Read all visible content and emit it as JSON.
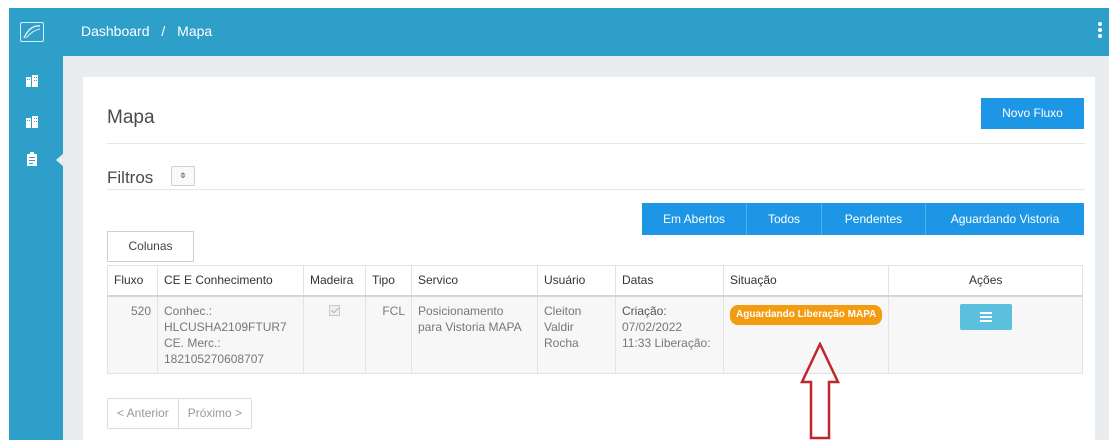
{
  "topbar": {
    "breadcrumb": [
      "Dashboard",
      "Mapa"
    ],
    "separator": "/"
  },
  "page": {
    "title": "Mapa",
    "new_button": "Novo Fluxo"
  },
  "filters": {
    "label": "Filtros",
    "toggle_icon": "eye-slash-icon",
    "buttons": [
      "Em Abertos",
      "Todos",
      "Pendentes",
      "Aguardando Vistoria"
    ]
  },
  "columns_button": "Colunas",
  "table": {
    "headers": [
      "Fluxo",
      "CE E Conhecimento",
      "Madeira",
      "Tipo",
      "Servico",
      "Usuário",
      "Datas",
      "Situação",
      "Ações"
    ],
    "rows": [
      {
        "fluxo": "520",
        "ce_lines": [
          "Conhec.:",
          "HLCUSHA2109FTUR7",
          "CE. Merc.:",
          "182105270608707"
        ],
        "madeira_checked": true,
        "tipo": "FCL",
        "servico_lines": [
          "Posicionamento",
          "para Vistoria MAPA"
        ],
        "usuario_lines": [
          "Cleiton",
          "Valdir",
          "Rocha"
        ],
        "datas_lines": [
          "Criação:",
          "07/02/2022",
          "11:33 Liberação:"
        ],
        "situacao": "Aguardando Liberação MAPA",
        "situacao_color": "#f39c12"
      }
    ]
  },
  "pager": {
    "prev": "< Anterior",
    "next": "Próximo >"
  },
  "colors": {
    "brand": "#2e9fc9",
    "primary_button": "#1e96e6",
    "action_button": "#5bc0de",
    "annotation_arrow": "#c0272d"
  }
}
